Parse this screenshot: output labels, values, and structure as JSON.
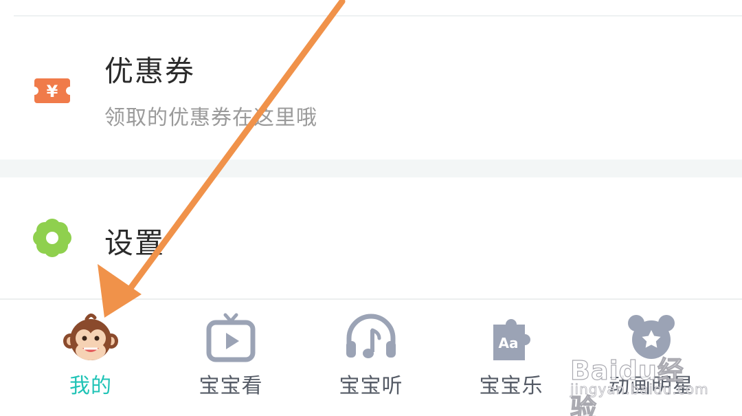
{
  "menu": {
    "coupon": {
      "icon": "coupon-ticket-icon",
      "title": "优惠券",
      "subtitle": "领取的优惠券在这里哦",
      "icon_glyph": "¥"
    },
    "settings": {
      "icon": "gear-flower-icon",
      "title": "设置"
    }
  },
  "tabbar": {
    "tabs": [
      {
        "label": "我的",
        "icon": "monkey-face-icon",
        "active": true
      },
      {
        "label": "宝宝看",
        "icon": "tv-play-icon",
        "active": false
      },
      {
        "label": "宝宝听",
        "icon": "headphones-music-icon",
        "active": false
      },
      {
        "label": "宝宝乐",
        "icon": "puzzle-aa-icon",
        "active": false
      },
      {
        "label": "动画明星",
        "icon": "bear-star-icon",
        "active": false
      }
    ],
    "puzzle_text": "Aa"
  },
  "watermark": {
    "brand": "Baidu经验",
    "url": "jingyan.baidu.com"
  },
  "colors": {
    "accent": "#1fc3b6",
    "coupon": "#f07b4a",
    "settings": "#8fd04e",
    "tab_icon": "#9ba3b5",
    "annotation_arrow": "#f0924a"
  }
}
